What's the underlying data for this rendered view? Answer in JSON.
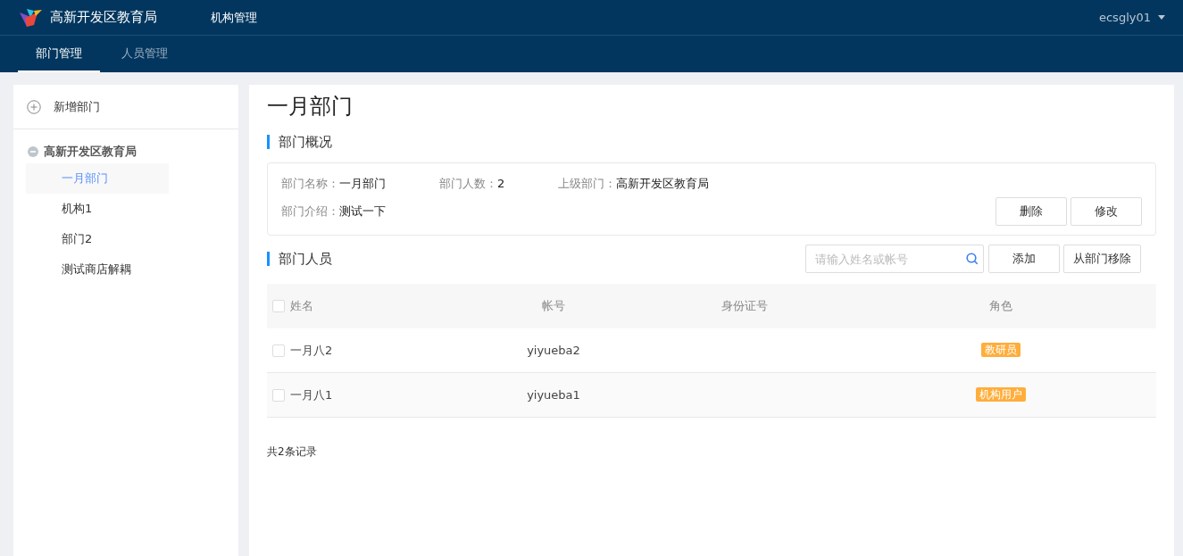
{
  "header": {
    "brand": "高新开发区教育局",
    "nav": [
      {
        "label": "机构管理",
        "selected": true
      }
    ],
    "user": "ecsgly01"
  },
  "tabs": [
    {
      "label": "部门管理",
      "selected": true
    },
    {
      "label": "人员管理",
      "selected": false
    }
  ],
  "sidebar": {
    "add_button": "新增部门",
    "tree": [
      {
        "label": "高新开发区教育局",
        "expanded": true,
        "children": [
          {
            "label": "一月部门",
            "selected": true
          },
          {
            "label": "机构1",
            "selected": false
          },
          {
            "label": "部门2",
            "selected": false
          },
          {
            "label": "测试商店解耦",
            "selected": false
          }
        ]
      }
    ]
  },
  "main": {
    "title": "一月部门",
    "overview_heading": "部门概况",
    "info": [
      {
        "label": "部门名称：",
        "value": "一月部门"
      },
      {
        "label": "部门人数：",
        "value": "2"
      },
      {
        "label": "上级部门：",
        "value": "高新开发区教育局"
      },
      {
        "label": "部门介绍：",
        "value": "测试一下"
      }
    ],
    "info_buttons": [
      "删除",
      "修改"
    ],
    "members_heading": "部门人员",
    "search": {
      "placeholder": "请输入姓名或帐号"
    },
    "member_buttons": [
      "添加",
      "从部门移除"
    ],
    "table": {
      "columns": [
        "姓名",
        "帐号",
        "身份证号",
        "角色"
      ],
      "header_checked": false,
      "rows": [
        {
          "checked": false,
          "name": "一月八2",
          "account": "yiyueba2",
          "role": "教研员"
        },
        {
          "checked": false,
          "name": "一月八1",
          "account": "yiyueba1",
          "role": "机构用户"
        }
      ]
    },
    "footer": "共2条记录"
  }
}
